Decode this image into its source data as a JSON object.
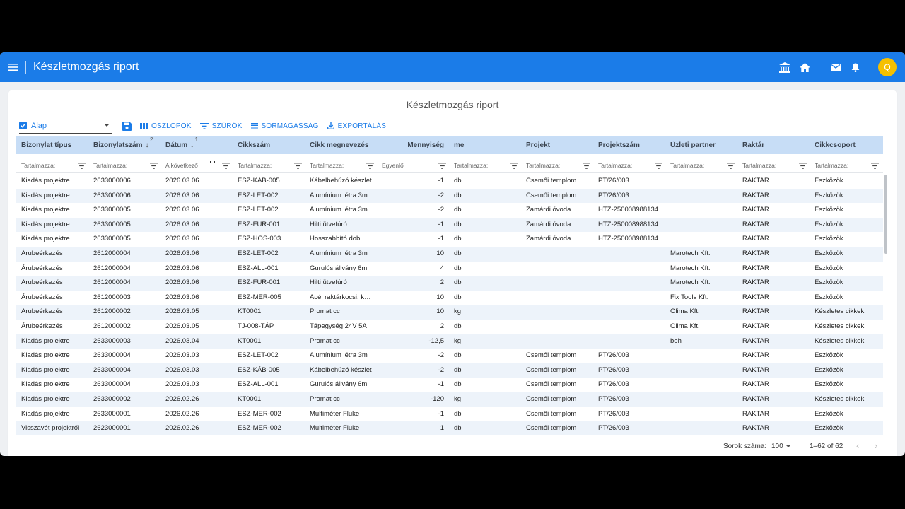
{
  "app": {
    "title": "Készletmozgás riport"
  },
  "report": {
    "title": "Készletmozgás riport"
  },
  "toolbar": {
    "view_name": "Alap",
    "columns_label": "OSZLOPOK",
    "filters_label": "SZŰRŐK",
    "density_label": "SORMAGASSÁG",
    "export_label": "EXPORTÁLÁS"
  },
  "user": {
    "initial": "Q"
  },
  "columns": [
    {
      "label": "Bizonylat típus",
      "filter": "Tartalmazza:"
    },
    {
      "label": "Bizonylatszám",
      "filter": "Tartalmazza:",
      "sort": "↓",
      "sort_index": "2"
    },
    {
      "label": "Dátum",
      "filter": "A következő",
      "sort": "↓",
      "sort_index": "1"
    },
    {
      "label": "Cikkszám",
      "filter": "Tartalmazza:"
    },
    {
      "label": "Cikk megnevezés",
      "filter": "Tartalmazza:"
    },
    {
      "label": "Mennyiség",
      "filter": "Egyenlő"
    },
    {
      "label": "me",
      "filter": "Tartalmazza:"
    },
    {
      "label": "Projekt",
      "filter": "Tartalmazza:"
    },
    {
      "label": "Projektszám",
      "filter": "Tartalmazza:"
    },
    {
      "label": "Üzleti partner",
      "filter": "Tartalmazza:"
    },
    {
      "label": "Raktár",
      "filter": "Tartalmazza:"
    },
    {
      "label": "Cikkcsoport",
      "filter": "Tartalmazza:"
    }
  ],
  "rows": [
    [
      "Kiadás projektre",
      "2633000006",
      "2026.03.06",
      "ESZ-KÁB-005",
      "Kábelbehúzó készlet",
      "-1",
      "db",
      "Csemői templom",
      "PT/26/003",
      "",
      "RAKTAR",
      "Eszközök"
    ],
    [
      "Kiadás projektre",
      "2633000006",
      "2026.03.06",
      "ESZ-LET-002",
      "Alumínium létra 3m",
      "-2",
      "db",
      "Csemői templom",
      "PT/26/003",
      "",
      "RAKTAR",
      "Eszközök"
    ],
    [
      "Kiadás projektre",
      "2633000005",
      "2026.03.06",
      "ESZ-LET-002",
      "Alumínium létra 3m",
      "-2",
      "db",
      "Zamárdi óvoda",
      "HTZ-250008988134",
      "",
      "RAKTAR",
      "Eszközök"
    ],
    [
      "Kiadás projektre",
      "2633000005",
      "2026.03.06",
      "ESZ-FUR-001",
      "Hilti ütvefúró",
      "-1",
      "db",
      "Zamárdi óvoda",
      "HTZ-250008988134",
      "",
      "RAKTAR",
      "Eszközök"
    ],
    [
      "Kiadás projektre",
      "2633000005",
      "2026.03.06",
      "ESZ-HOS-003",
      "Hosszabbító dob …",
      "-1",
      "db",
      "Zamárdi óvoda",
      "HTZ-250008988134",
      "",
      "RAKTAR",
      "Eszközök"
    ],
    [
      "Árubeérkezés",
      "2612000004",
      "2026.03.06",
      "ESZ-LET-002",
      "Alumínium létra 3m",
      "10",
      "db",
      "",
      "",
      "Marotech Kft.",
      "RAKTAR",
      "Eszközök"
    ],
    [
      "Árubeérkezés",
      "2612000004",
      "2026.03.06",
      "ESZ-ALL-001",
      "Gurulós állvány 6m",
      "4",
      "db",
      "",
      "",
      "Marotech Kft.",
      "RAKTAR",
      "Eszközök"
    ],
    [
      "Árubeérkezés",
      "2612000004",
      "2026.03.06",
      "ESZ-FUR-001",
      "Hilti ütvefúró",
      "2",
      "db",
      "",
      "",
      "Marotech Kft.",
      "RAKTAR",
      "Eszközök"
    ],
    [
      "Árubeérkezés",
      "2612000003",
      "2026.03.06",
      "ESZ-MER-005",
      "Acél raktárkocsi, k…",
      "10",
      "db",
      "",
      "",
      "Fix Tools Kft.",
      "RAKTAR",
      "Eszközök"
    ],
    [
      "Árubeérkezés",
      "2612000002",
      "2026.03.05",
      "KT0001",
      "Promat cc",
      "10",
      "kg",
      "",
      "",
      "Olima Kft.",
      "RAKTAR",
      "Készletes cikkek"
    ],
    [
      "Árubeérkezés",
      "2612000002",
      "2026.03.05",
      "TJ-008-TÁP",
      "Tápegység 24V 5A",
      "2",
      "db",
      "",
      "",
      "Olima Kft.",
      "RAKTAR",
      "Készletes cikkek"
    ],
    [
      "Kiadás projektre",
      "2633000003",
      "2026.03.04",
      "KT0001",
      "Promat cc",
      "-12,5",
      "kg",
      "",
      "",
      "boh",
      "RAKTAR",
      "Készletes cikkek"
    ],
    [
      "Kiadás projektre",
      "2633000004",
      "2026.03.03",
      "ESZ-LET-002",
      "Alumínium létra 3m",
      "-2",
      "db",
      "Csemői templom",
      "PT/26/003",
      "",
      "RAKTAR",
      "Eszközök"
    ],
    [
      "Kiadás projektre",
      "2633000004",
      "2026.03.03",
      "ESZ-KÁB-005",
      "Kábelbehúzó készlet",
      "-2",
      "db",
      "Csemői templom",
      "PT/26/003",
      "",
      "RAKTAR",
      "Eszközök"
    ],
    [
      "Kiadás projektre",
      "2633000004",
      "2026.03.03",
      "ESZ-ALL-001",
      "Gurulós állvány 6m",
      "-1",
      "db",
      "Csemői templom",
      "PT/26/003",
      "",
      "RAKTAR",
      "Eszközök"
    ],
    [
      "Kiadás projektre",
      "2633000002",
      "2026.02.26",
      "KT0001",
      "Promat cc",
      "-120",
      "kg",
      "Csemői templom",
      "PT/26/003",
      "",
      "RAKTAR",
      "Készletes cikkek"
    ],
    [
      "Kiadás projektre",
      "2633000001",
      "2026.02.26",
      "ESZ-MER-002",
      "Multiméter Fluke",
      "-1",
      "db",
      "Csemői templom",
      "PT/26/003",
      "",
      "RAKTAR",
      "Eszközök"
    ],
    [
      "Visszavét projektről",
      "2623000001",
      "2026.02.26",
      "ESZ-MER-002",
      "Multiméter Fluke",
      "1",
      "db",
      "Csemői templom",
      "PT/26/003",
      "",
      "RAKTAR",
      "Eszközök"
    ]
  ],
  "footer": {
    "rows_per_page_label": "Sorok száma:",
    "rows_per_page": "100",
    "range": "1–62 of 62"
  },
  "colors": {
    "topbar": "#1b7ce8",
    "header_bg": "#c7ddf6",
    "row_alt": "#edf3fa",
    "avatar": "#f5c000"
  }
}
